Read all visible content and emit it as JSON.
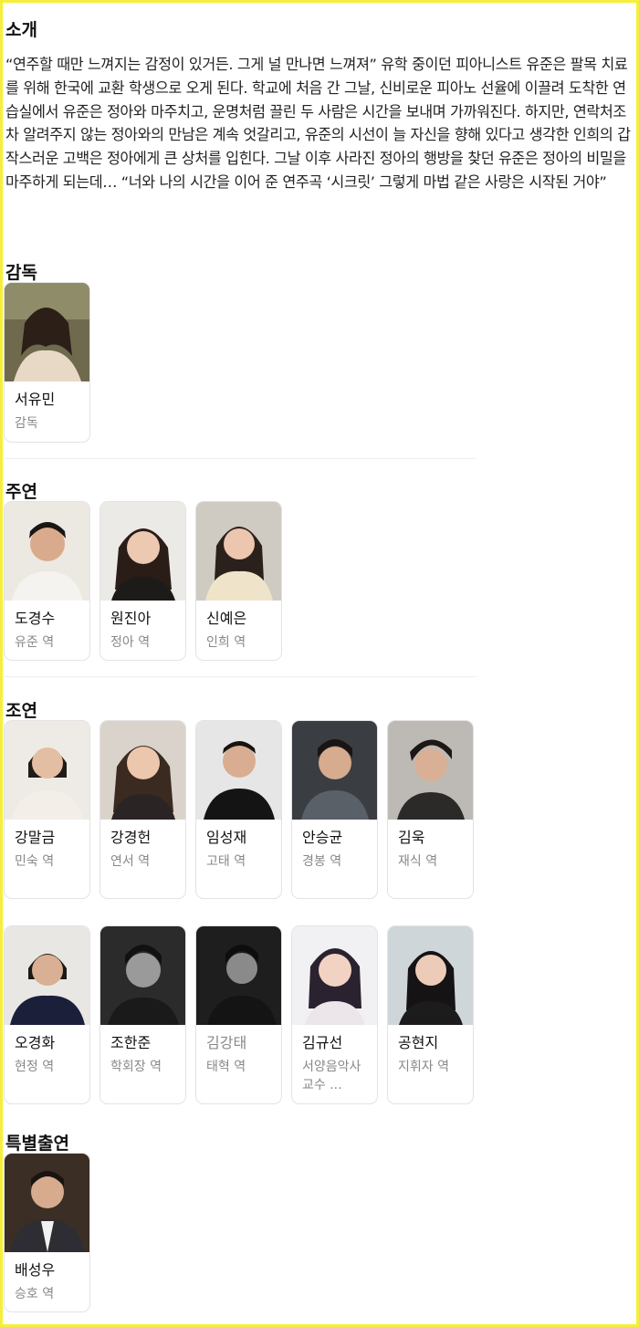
{
  "intro": {
    "heading": "소개",
    "text": "“연주할 때만 느껴지는 감정이 있거든. 그게 널 만나면 느껴져” 유학 중이던 피아니스트 유준은 팔목 치료를 위해 한국에 교환 학생으로 오게 된다. 학교에 처음 간 그날, 신비로운 피아노 선율에 이끌려 도착한 연습실에서 유준은 정아와 마주치고, 운명처럼 끌린 두 사람은 시간을 보내며 가까워진다. 하지만, 연락처조차 알려주지 않는 정아와의 만남은 계속 엇갈리고, 유준의 시선이 늘 자신을 향해 있다고 생각한 인희의 갑작스러운 고백은 정아에게 큰 상처를 입힌다. 그날 이후 사라진 정아의 행방을 찾던 유준은 정아의 비밀을 마주하게 되는데… “너와 나의 시간을 이어 준 연주곡 ‘시크릿’ 그렇게 마법 같은 사랑은 시작된 거야”"
  },
  "director": {
    "heading": "감독",
    "people": [
      {
        "name": "서유민",
        "role": "감독"
      }
    ]
  },
  "leads": {
    "heading": "주연",
    "people": [
      {
        "name": "도경수",
        "role": "유준 역"
      },
      {
        "name": "원진아",
        "role": "정아 역"
      },
      {
        "name": "신예은",
        "role": "인희 역"
      }
    ]
  },
  "supporting": {
    "heading": "조연",
    "people": [
      {
        "name": "강말금",
        "role": "민숙 역"
      },
      {
        "name": "강경헌",
        "role": "연서 역"
      },
      {
        "name": "임성재",
        "role": "고태 역"
      },
      {
        "name": "안승균",
        "role": "경봉 역"
      },
      {
        "name": "김욱",
        "role": "재식 역"
      },
      {
        "name": "오경화",
        "role": "현정 역"
      },
      {
        "name": "조한준",
        "role": "학회장 역"
      },
      {
        "name": "김강태",
        "role": "태혁 역"
      },
      {
        "name": "김규선",
        "role": "서양음악사 교수 ..."
      },
      {
        "name": "공현지",
        "role": "지휘자 역"
      }
    ]
  },
  "special": {
    "heading": "특별출연",
    "people": [
      {
        "name": "배성우",
        "role": "승호 역"
      }
    ]
  },
  "colors": {
    "frame": "#f5ef3a",
    "card_border": "#e3e3e3",
    "muted_text": "#888888"
  }
}
